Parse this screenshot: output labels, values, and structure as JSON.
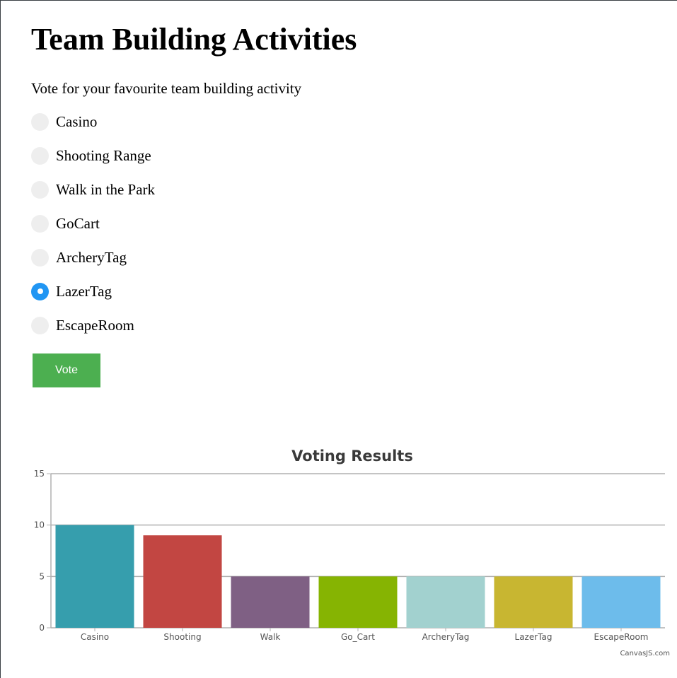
{
  "page": {
    "title": "Team Building Activities",
    "subtitle": "Vote for your favourite team building activity"
  },
  "poll": {
    "options": [
      {
        "label": "Casino",
        "checked": false
      },
      {
        "label": "Shooting Range",
        "checked": false
      },
      {
        "label": "Walk in the Park",
        "checked": false
      },
      {
        "label": "GoCart",
        "checked": false
      },
      {
        "label": "ArcheryTag",
        "checked": false
      },
      {
        "label": "LazerTag",
        "checked": true
      },
      {
        "label": "EscapeRoom",
        "checked": false
      }
    ],
    "vote_label": "Vote"
  },
  "colors": {
    "radio_checked": "#2196f3",
    "radio_unchecked": "#eeeeee",
    "vote_button": "#4caf50"
  },
  "chart_data": {
    "type": "bar",
    "title": "Voting Results",
    "categories": [
      "Casino",
      "Shooting",
      "Walk",
      "Go_Cart",
      "ArcheryTag",
      "LazerTag",
      "EscapeRoom"
    ],
    "values": [
      10,
      9,
      5,
      5,
      5,
      5,
      5
    ],
    "colors": [
      "#369ead",
      "#c24642",
      "#7f6084",
      "#86b402",
      "#a2d1cf",
      "#c8b631",
      "#6dbceb"
    ],
    "ylim": [
      0,
      15
    ],
    "yticks": [
      0,
      5,
      10,
      15
    ],
    "grid": true,
    "credit": "CanvasJS.com"
  }
}
